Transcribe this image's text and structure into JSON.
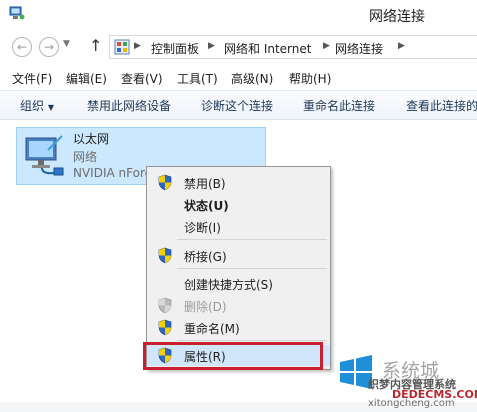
{
  "window": {
    "title": "网络连接"
  },
  "nav": {
    "back_glyph": "←",
    "forward_glyph": "→",
    "up_glyph": "↑",
    "breadcrumb": [
      "控制面板",
      "网络和 Internet",
      "网络连接"
    ]
  },
  "menubar": [
    "文件(F)",
    "编辑(E)",
    "查看(V)",
    "工具(T)",
    "高级(N)",
    "帮助(H)"
  ],
  "commandbar": {
    "organize": "组织",
    "disable": "禁用此网络设备",
    "diagnose": "诊断这个连接",
    "rename": "重命名此连接",
    "view_status": "查看此连接的"
  },
  "connection": {
    "name": "以太网",
    "type": "网络",
    "device": "NVIDIA nForce"
  },
  "context_menu": {
    "disable": "禁用(B)",
    "status": "状态(U)",
    "diagnose": "诊断(I)",
    "bridge": "桥接(G)",
    "shortcut": "创建快捷方式(S)",
    "delete": "删除(D)",
    "rename": "重命名(M)",
    "properties": "属性(R)"
  },
  "watermark": {
    "big": "系统城",
    "line1": "织梦内容管理系统",
    "line2": "DEDECMS.COM",
    "line3": "xitongcheng.com"
  },
  "colors": {
    "highlight_border": "#c8202f",
    "tile_selected": "#cce8ff",
    "menu_hover": "#d1e6fa"
  },
  "icons": {
    "app": "network-connections-icon",
    "address": "control-panel-icon",
    "connection": "ethernet-adapter-icon",
    "uac": "uac-shield-icon",
    "watermark": "windows-logo-icon"
  }
}
